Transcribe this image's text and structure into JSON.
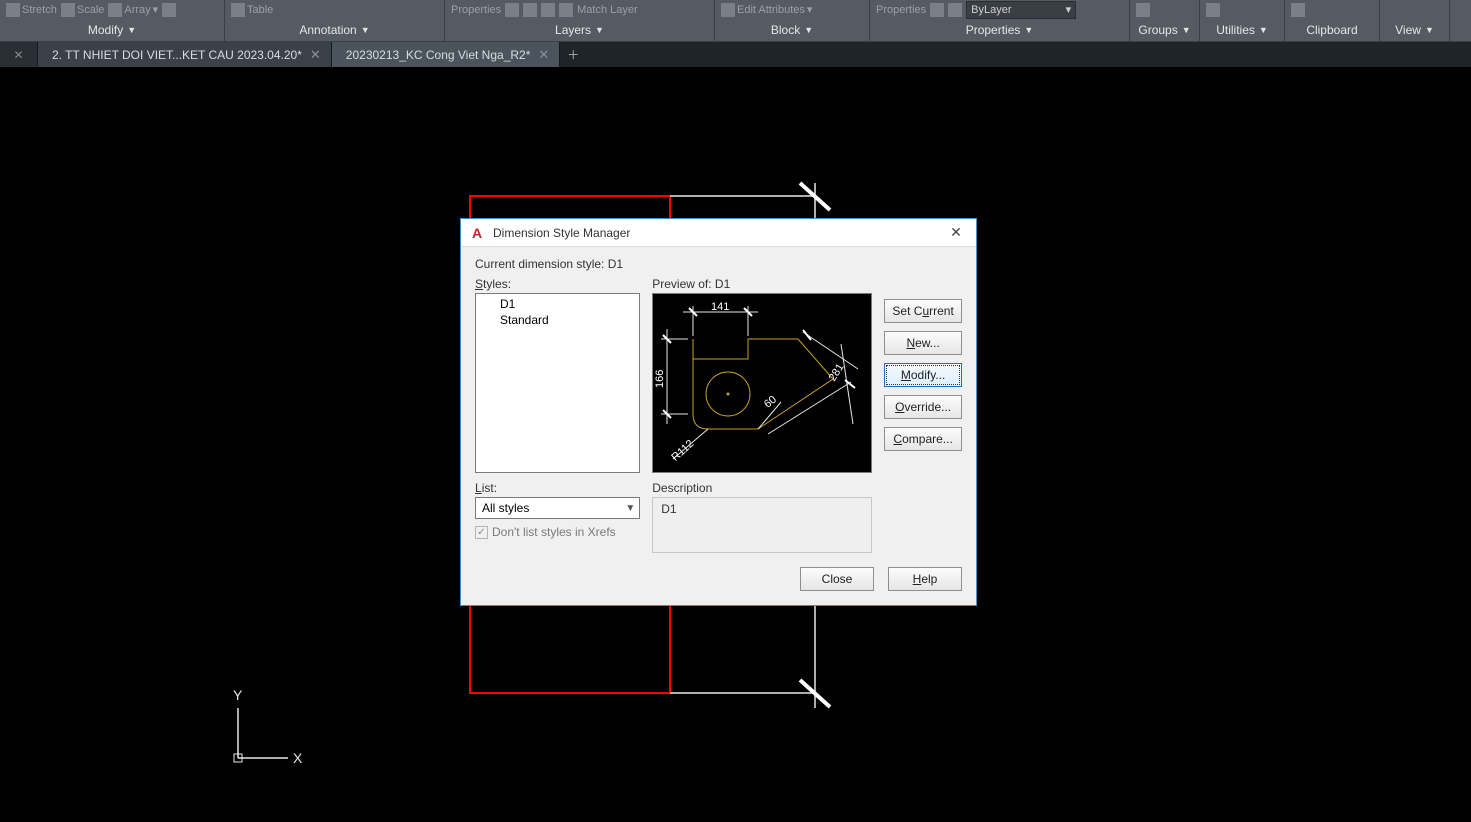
{
  "ribbon": {
    "modify": {
      "label": "Modify",
      "stretch": "Stretch",
      "scale": "Scale",
      "array": "Array"
    },
    "annotation": {
      "label": "Annotation",
      "table": "Table"
    },
    "layers": {
      "label": "Layers",
      "properties": "Properties",
      "matchLayer": "Match Layer"
    },
    "block": {
      "label": "Block",
      "editAttr": "Edit Attributes"
    },
    "properties": {
      "label": "Properties",
      "propBtn": "Properties",
      "bylayer": "ByLayer"
    },
    "groups": {
      "label": "Groups"
    },
    "utilities": {
      "label": "Utilities"
    },
    "clipboard": {
      "label": "Clipboard"
    },
    "view": {
      "label": "View"
    }
  },
  "tabs": {
    "t1": "2. TT NHIET DOI VIET...KET CAU 2023.04.20*",
    "t2": "20230213_KC Cong Viet Nga_R2*"
  },
  "ucs": {
    "x": "X",
    "y": "Y"
  },
  "dialog": {
    "title": "Dimension Style Manager",
    "current": "Current dimension style: D1",
    "stylesLabel": "Styles:",
    "styleItems": {
      "i0": "D1",
      "i1": "Standard"
    },
    "previewLabel": "Preview of: D1",
    "listLabel": "List:",
    "listValue": "All styles",
    "dontList": "Don't list styles in Xrefs",
    "descLabel": "Description",
    "descValue": "D1",
    "buttons": {
      "setCurrent": "Set Current",
      "new": "New...",
      "modify": "Modify...",
      "override": "Override...",
      "compare": "Compare...",
      "close": "Close",
      "help": "Help"
    },
    "previewDims": {
      "d1": "141",
      "d2": "166",
      "d3": "281",
      "d4": "60",
      "d5": "R112"
    }
  }
}
